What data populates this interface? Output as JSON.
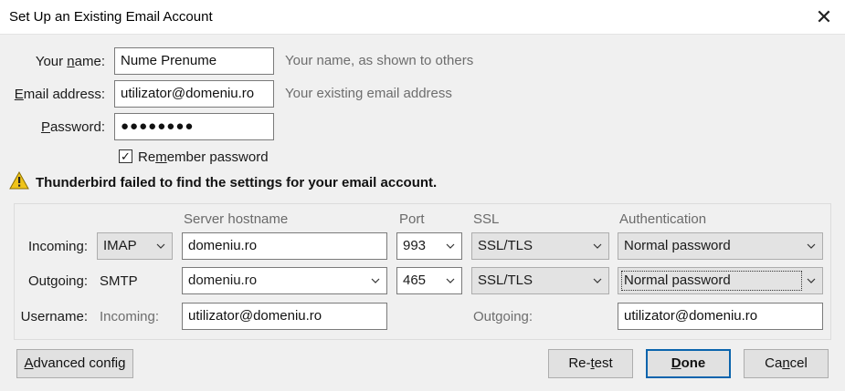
{
  "window": {
    "title": "Set Up an Existing Email Account",
    "close": "✕"
  },
  "identity": {
    "name_label": [
      "Your ",
      "n",
      "ame:"
    ],
    "name_value": "Nume Prenume",
    "name_hint": "Your name, as shown to others",
    "email_label": [
      "",
      "E",
      "mail address:"
    ],
    "email_value": "utilizator@domeniu.ro",
    "email_hint": "Your existing email address",
    "password_label": [
      "",
      "P",
      "assword:"
    ],
    "password_value": "●●●●●●●●",
    "remember_label": [
      "Re",
      "m",
      "ember password"
    ],
    "remember_checked": true
  },
  "warning": {
    "icon": "warning-triangle-icon",
    "text": "Thunderbird failed to find the settings for your email account."
  },
  "server": {
    "headers": {
      "hostname": "Server hostname",
      "port": "Port",
      "ssl": "SSL",
      "auth": "Authentication"
    },
    "incoming": {
      "label": "Incoming:",
      "protocol": "IMAP",
      "hostname": "domeniu.ro",
      "port": "993",
      "ssl": "SSL/TLS",
      "auth": "Normal password"
    },
    "outgoing": {
      "label": "Outgoing:",
      "protocol": "SMTP",
      "hostname": "domeniu.ro",
      "port": "465",
      "ssl": "SSL/TLS",
      "auth": "Normal password"
    },
    "username": {
      "label": "Username:",
      "incoming_label": "Incoming:",
      "incoming_value": "utilizator@domeniu.ro",
      "outgoing_label": "Outgoing:",
      "outgoing_value": "utilizator@domeniu.ro"
    }
  },
  "buttons": {
    "advanced": [
      "",
      "A",
      "dvanced config"
    ],
    "retest": [
      "Re-",
      "t",
      "est"
    ],
    "done": [
      "",
      "D",
      "one"
    ],
    "cancel": [
      "Ca",
      "n",
      "cel"
    ]
  },
  "colors": {
    "accent": "#0a64ad",
    "background": "#f0f0f0",
    "warning": "#f0c419"
  }
}
